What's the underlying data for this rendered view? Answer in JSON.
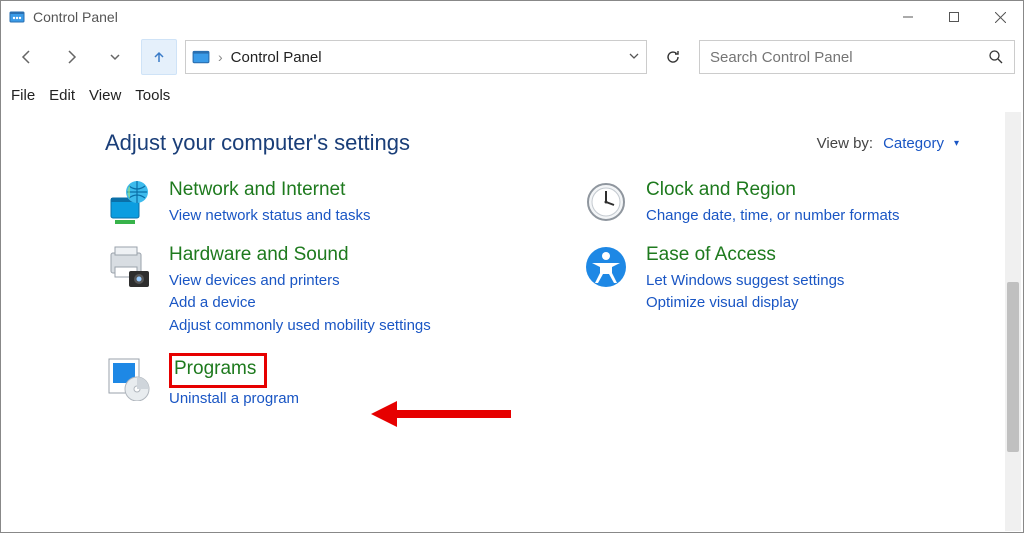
{
  "window": {
    "title": "Control Panel"
  },
  "address": {
    "location": "Control Panel"
  },
  "search": {
    "placeholder": "Search Control Panel"
  },
  "menu": {
    "file": "File",
    "edit": "Edit",
    "view": "View",
    "tools": "Tools"
  },
  "header": {
    "title": "Adjust your computer's settings"
  },
  "viewby": {
    "label": "View by:",
    "value": "Category"
  },
  "left": {
    "net": {
      "title": "Network and Internet",
      "l1": "View network status and tasks"
    },
    "hw": {
      "title": "Hardware and Sound",
      "l1": "View devices and printers",
      "l2": "Add a device",
      "l3": "Adjust commonly used mobility settings"
    },
    "prog": {
      "title": "Programs",
      "l1": "Uninstall a program"
    }
  },
  "right": {
    "clock": {
      "title": "Clock and Region",
      "l1": "Change date, time, or number formats"
    },
    "ease": {
      "title": "Ease of Access",
      "l1": "Let Windows suggest settings",
      "l2": "Optimize visual display"
    }
  }
}
